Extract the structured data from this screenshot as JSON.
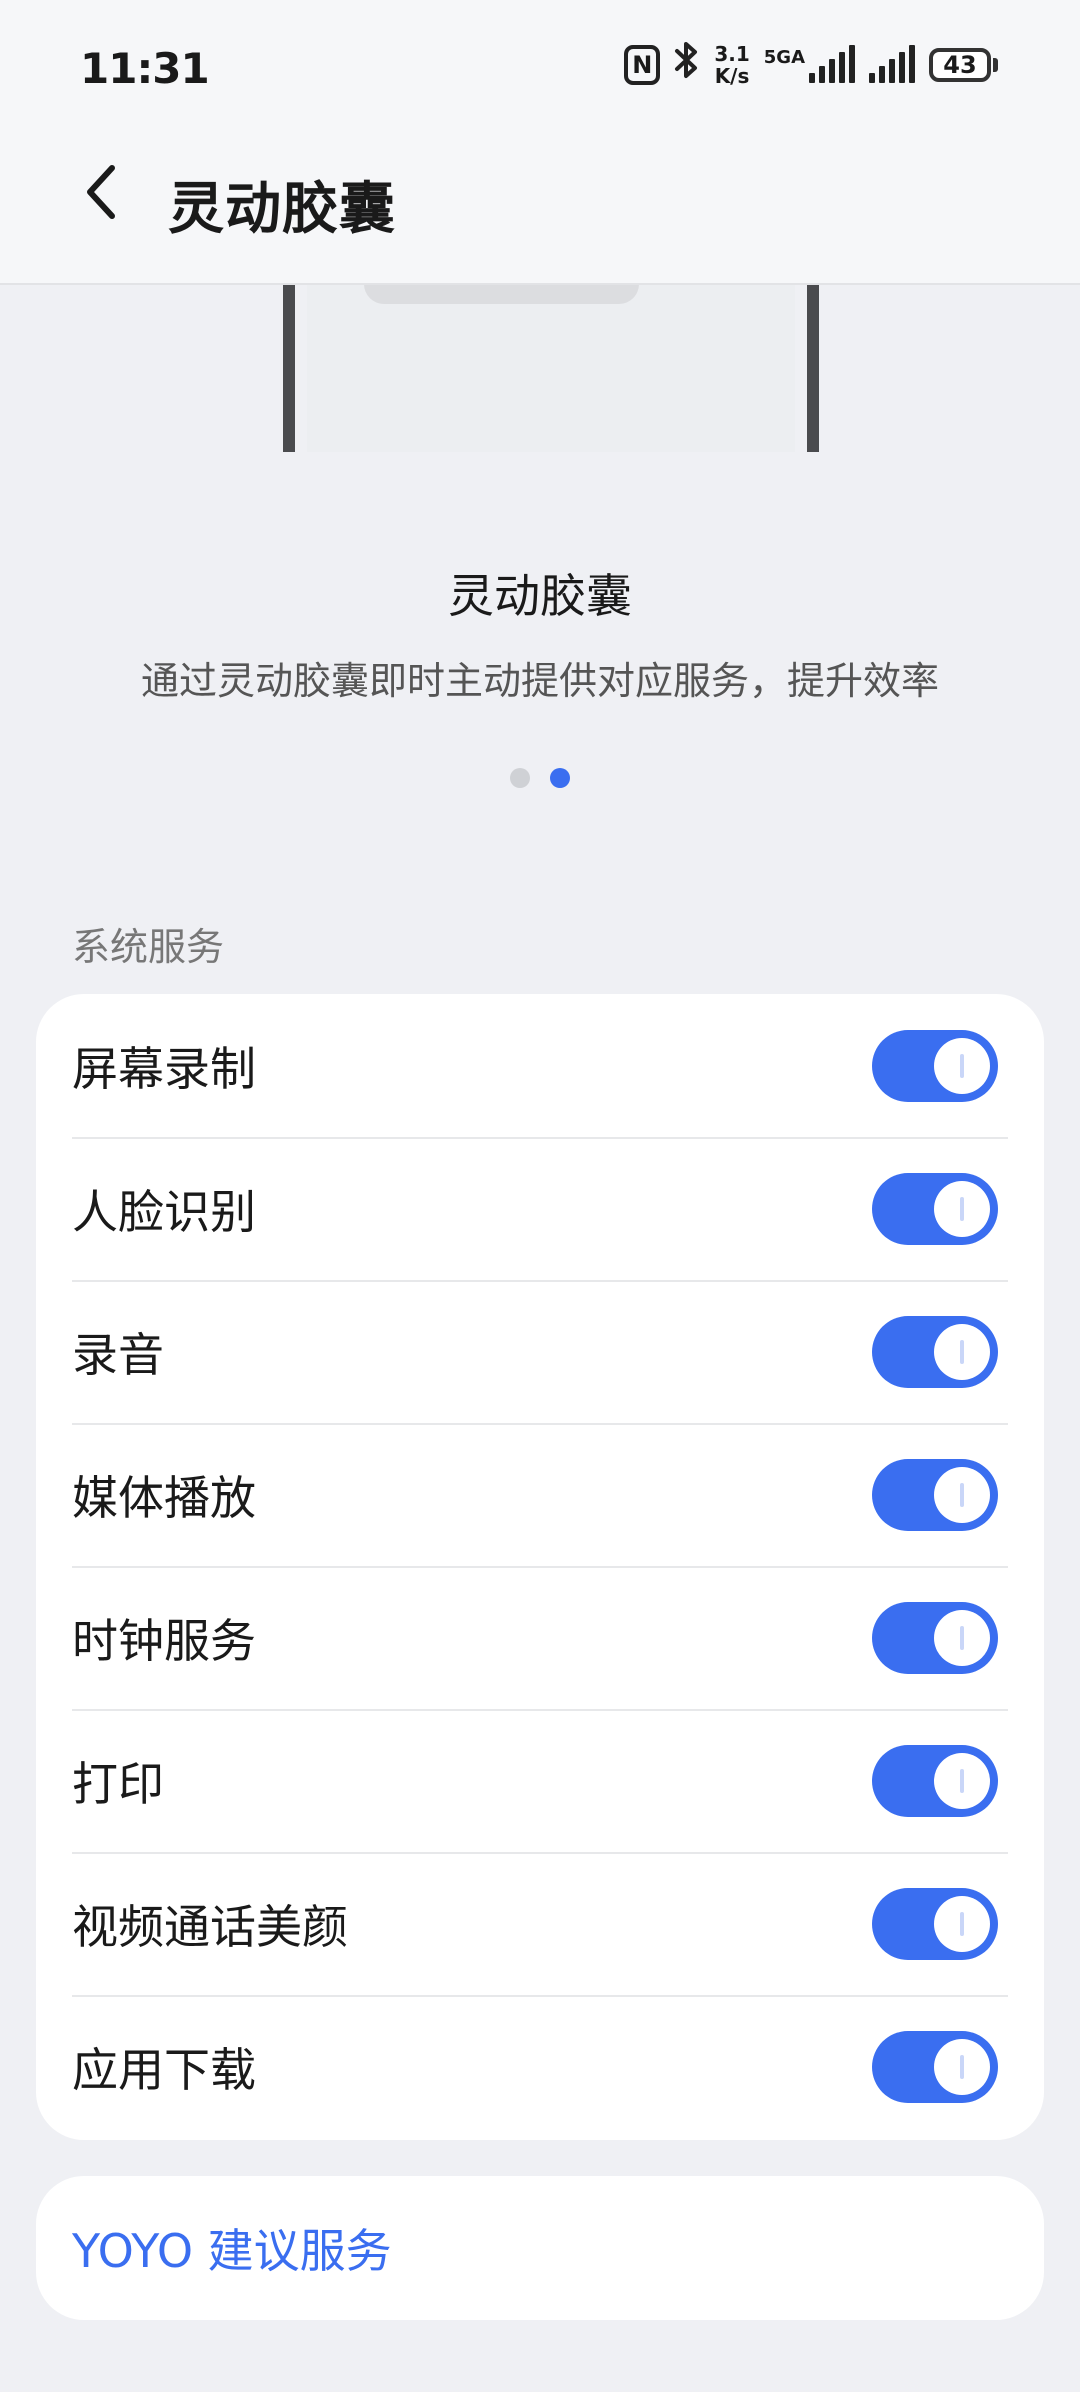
{
  "status_bar": {
    "time": "11:31",
    "nfc": "N",
    "bluetooth_icon": "bluetooth-icon",
    "speed_value": "3.1",
    "speed_unit": "K/s",
    "network_label": "5GA",
    "battery": "43"
  },
  "header": {
    "back_icon": "chevron-left-icon",
    "title": "灵动胶囊"
  },
  "intro": {
    "title": "灵动胶囊",
    "subtitle": "通过灵动胶囊即时主动提供对应服务，提升效率",
    "page_indicator": {
      "count": 2,
      "active_index": 1
    }
  },
  "section": {
    "label": "系统服务",
    "items": [
      {
        "label": "屏幕录制",
        "enabled": true
      },
      {
        "label": "人脸识别",
        "enabled": true
      },
      {
        "label": "录音",
        "enabled": true
      },
      {
        "label": "媒体播放",
        "enabled": true
      },
      {
        "label": "时钟服务",
        "enabled": true
      },
      {
        "label": "打印",
        "enabled": true
      },
      {
        "label": "视频通话美颜",
        "enabled": true
      },
      {
        "label": "应用下载",
        "enabled": true
      }
    ]
  },
  "yoyo": {
    "label": "YOYO 建议服务"
  },
  "colors": {
    "accent": "#3a6ef0",
    "background": "#eff0f4",
    "card": "#ffffff"
  }
}
